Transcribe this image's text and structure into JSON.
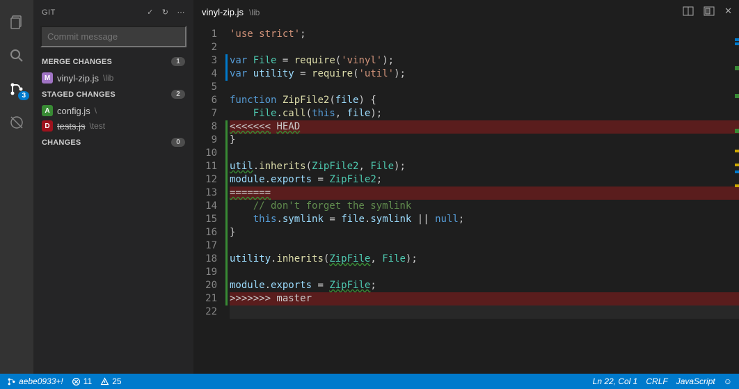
{
  "activity": {
    "scm_badge": "3"
  },
  "side": {
    "title": "GIT",
    "commit_placeholder": "Commit message",
    "sections": {
      "merge": {
        "label": "MERGE CHANGES",
        "count": "1",
        "items": [
          {
            "name": "vinyl-zip.js",
            "dir": "\\lib",
            "letter": "M",
            "cls": "lm"
          }
        ]
      },
      "staged": {
        "label": "STAGED CHANGES",
        "count": "2",
        "items": [
          {
            "name": "config.js",
            "dir": "\\",
            "letter": "A",
            "cls": "la"
          },
          {
            "name": "tests.js",
            "dir": "\\test",
            "letter": "D",
            "cls": "ld",
            "strike": true
          }
        ]
      },
      "changes": {
        "label": "CHANGES",
        "count": "0"
      }
    }
  },
  "tab": {
    "name": "vinyl-zip.js",
    "dir": "\\lib"
  },
  "code": {
    "lines": [
      {
        "n": 1,
        "html": "<span class='s'>'use strict'</span>;"
      },
      {
        "n": 2,
        "html": ""
      },
      {
        "n": 3,
        "html": "<span class='k'>var</span> <span class='n'>File</span> = <span class='f'>require</span>(<span class='s'>'vinyl'</span>);",
        "m": "#007acc"
      },
      {
        "n": 4,
        "html": "<span class='k'>var</span> <span class='v'>utility</span> = <span class='f'>require</span>(<span class='s'>'util'</span>);",
        "m": "#007acc"
      },
      {
        "n": 5,
        "html": ""
      },
      {
        "n": 6,
        "html": "<span class='k'>function</span> <span class='f'>ZipFile2</span>(<span class='v'>file</span>) {"
      },
      {
        "n": 7,
        "html": "    <span class='n'>File</span>.<span class='f'>call</span>(<span class='k'>this</span>, <span class='v'>file</span>);"
      },
      {
        "n": 8,
        "html": "<span class='sq'>&lt;&lt;&lt;&lt;&lt;&lt;&lt;</span> <span class='sq'>HEAD</span>",
        "cls": "conflict",
        "m": "#388a34"
      },
      {
        "n": 9,
        "html": "}",
        "m": "#388a34"
      },
      {
        "n": 10,
        "html": "",
        "m": "#388a34"
      },
      {
        "n": 11,
        "html": "<span class='v sq'>util</span>.<span class='f'>inherits</span>(<span class='n'>ZipFile2</span>, <span class='n'>File</span>);",
        "m": "#388a34"
      },
      {
        "n": 12,
        "html": "<span class='v'>module</span>.<span class='v'>exports</span> = <span class='n'>ZipFile2</span>;",
        "m": "#388a34"
      },
      {
        "n": 13,
        "html": "<span class='sq'>=======</span>",
        "cls": "conflict",
        "m": "#388a34"
      },
      {
        "n": 14,
        "html": "    <span class='c'>// don't forget the symlink</span>",
        "m": "#388a34"
      },
      {
        "n": 15,
        "html": "    <span class='k'>this</span>.<span class='v'>symlink</span> = <span class='v'>file</span>.<span class='v'>symlink</span> || <span class='k'>null</span>;",
        "m": "#388a34"
      },
      {
        "n": 16,
        "html": "}",
        "m": "#388a34"
      },
      {
        "n": 17,
        "html": "",
        "m": "#388a34"
      },
      {
        "n": 18,
        "html": "<span class='v'>utility</span>.<span class='f'>inherits</span>(<span class='n sq'>ZipFile</span>, <span class='n'>File</span>);",
        "m": "#388a34"
      },
      {
        "n": 19,
        "html": "",
        "m": "#388a34"
      },
      {
        "n": 20,
        "html": "<span class='v'>module</span>.<span class='v'>exports</span> = <span class='n sq'>ZipFile</span>;",
        "m": "#388a34"
      },
      {
        "n": 21,
        "html": "&gt;&gt;&gt;&gt;&gt;&gt;&gt; master",
        "cls": "conflict",
        "m": "#388a34"
      },
      {
        "n": 22,
        "html": "",
        "cls": "cur"
      }
    ]
  },
  "status": {
    "branch": "aebe0933+!",
    "errors": "11",
    "warnings": "25",
    "pos": "Ln 22, Col 1",
    "eol": "CRLF",
    "lang": "JavaScript"
  }
}
